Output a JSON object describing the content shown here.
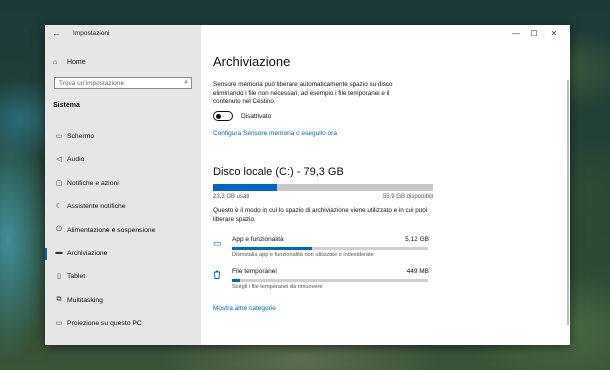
{
  "window": {
    "title": "Impostazioni",
    "controls": {
      "minimize": "—",
      "maximize": "☐",
      "close": "✕"
    }
  },
  "sidebar": {
    "home_label": "Home",
    "search_placeholder": "Trova un'impostazione",
    "section_title": "Sistema",
    "items": [
      {
        "label": "Schermo",
        "icon": "monitor-icon",
        "glyph": "▭"
      },
      {
        "label": "Audio",
        "icon": "speaker-icon",
        "glyph": "◁"
      },
      {
        "label": "Notifiche e azioni",
        "icon": "notification-icon",
        "glyph": "▢"
      },
      {
        "label": "Assistente notifiche",
        "icon": "moon-icon",
        "glyph": "☾"
      },
      {
        "label": "Alimentazione e sospensione",
        "icon": "power-icon",
        "glyph": "⏻"
      },
      {
        "label": "Archiviazione",
        "icon": "storage-icon",
        "glyph": "▬",
        "active": true
      },
      {
        "label": "Tablet",
        "icon": "tablet-icon",
        "glyph": "▯"
      },
      {
        "label": "Multitasking",
        "icon": "multitasking-icon",
        "glyph": "⧉"
      },
      {
        "label": "Proiezione su questo PC",
        "icon": "projection-icon",
        "glyph": "▭"
      }
    ]
  },
  "main": {
    "title": "Archiviazione",
    "storage_sense_description": "Sensore memoria può liberare automaticamente spazio su disco eliminando i file non necessari, ad esempio i file temporanei e il contenuto nel Cestino.",
    "toggle_state": "Disattivato",
    "configure_link": "Configura Sensore memoria o eseguilo ora",
    "disk": {
      "title": "Disco locale (C:) - 79,3 GB",
      "used_label": "23,3 GB usati",
      "free_label": "55,9 GB disponibili",
      "used_fraction": 0.29
    },
    "disk_explanation": "Questo è il modo in cui lo spazio di archiviazione viene utilizzato e in cui puoi liberare spazio.",
    "categories": [
      {
        "name": "App e funzionalità",
        "size": "5,12 GB",
        "description": "Disinstalla app e funzionalità non utilizzate o indesiderate",
        "icon": "apps-icon",
        "glyph": "▭",
        "fraction": 0.41
      },
      {
        "name": "File temporanei",
        "size": "449 MB",
        "description": "Scegli i file temporanei da rimuovere",
        "icon": "trash-icon",
        "glyph": "🗑",
        "fraction": 0.04
      }
    ],
    "more_categories_link": "Mostra altre categorie"
  },
  "colors": {
    "accent": "#0067c0",
    "sidebar_background": "#e6e6e6",
    "bar_empty": "#c8c8c8"
  }
}
